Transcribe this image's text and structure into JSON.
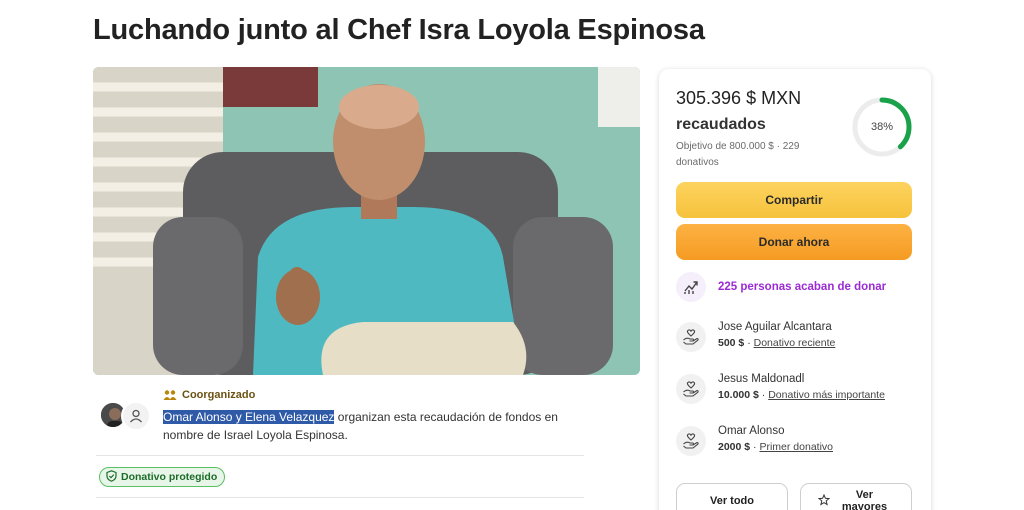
{
  "page": {
    "title": "Luchando junto al Chef Isra Loyola Espinosa"
  },
  "organizer": {
    "badge": "Coorganizado",
    "names": "Omar Alonso y Elena Velazquez",
    "text": " organizan esta recaudación de fondos en nombre de Israel Loyola Espinosa."
  },
  "protected_badge": "Donativo protegido",
  "card": {
    "raised_amount": "305.396 $ MXN",
    "raised_label": "recaudados",
    "goal_text": "Objetivo de 800.000 $ · 229 donativos",
    "progress_label": "38%",
    "progress_value": 0.38,
    "share_label": "Compartir",
    "donate_label": "Donar ahora",
    "recent_text": "225 personas acaban de donar",
    "donors": [
      {
        "name": "Jose Aguilar Alcantara",
        "amount": "500 $",
        "tag": "Donativo reciente"
      },
      {
        "name": "Jesus Maldonadl",
        "amount": "10.000 $",
        "tag": "Donativo más importante"
      },
      {
        "name": "Omar Alonso",
        "amount": "2000 $",
        "tag": "Primer donativo"
      }
    ],
    "see_all_label": "Ver todo",
    "see_top_label": "Ver mayores"
  },
  "colors": {
    "progress": "#19a24a",
    "share_button": "#f6c23c",
    "donate_button": "#f59b23",
    "recent_purple": "#9b2bd4",
    "protected_green": "#5bbf63"
  },
  "icons": {
    "coorganizer": "group-icon",
    "trend": "trending-up-icon",
    "donor": "donor-hand-heart-icon",
    "protected": "shield-check-icon",
    "top": "star-icon",
    "avatar": "person-icon"
  }
}
